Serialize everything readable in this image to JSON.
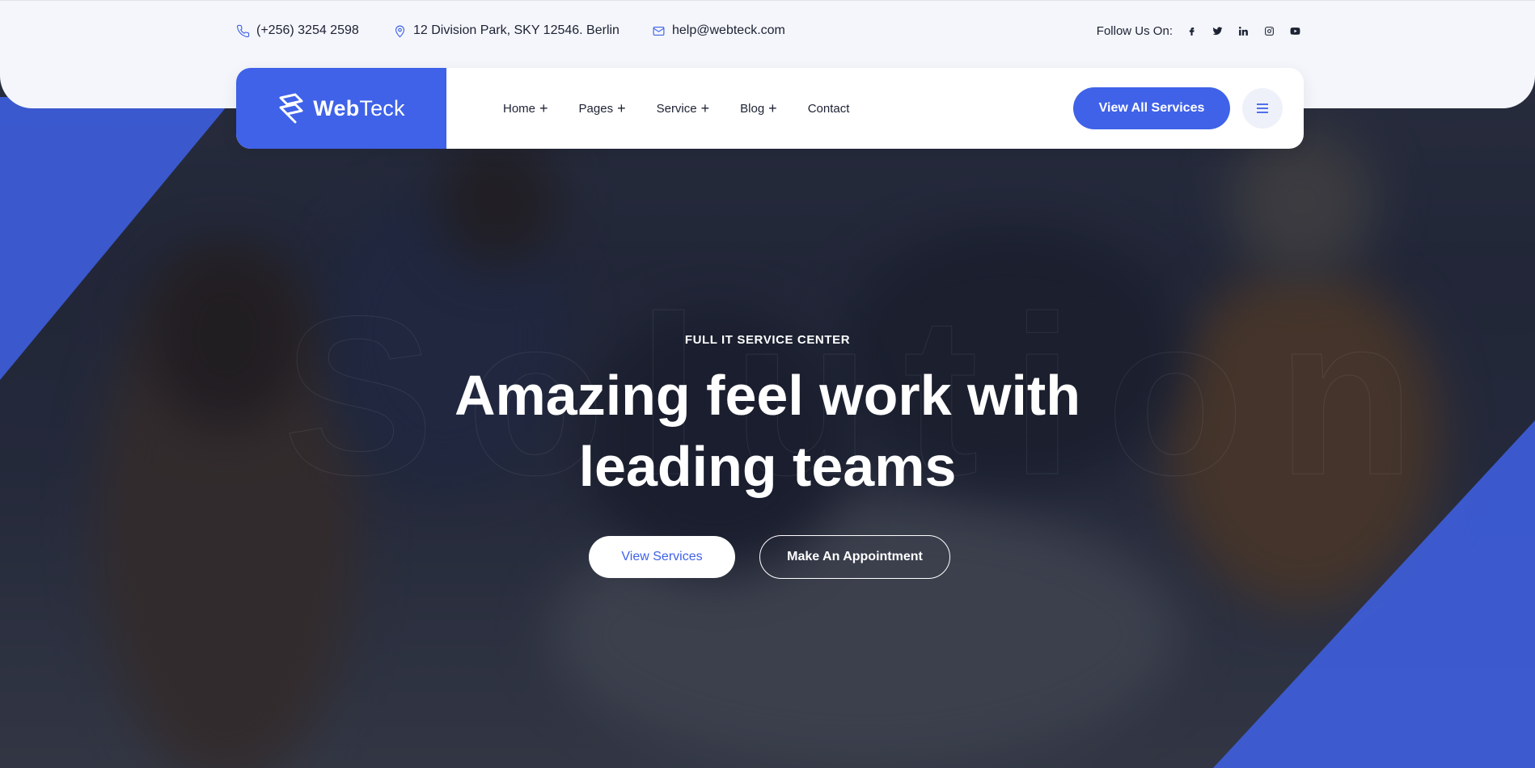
{
  "topbar": {
    "phone": "(+256) 3254 2598",
    "address": "12 Division Park, SKY 12546. Berlin",
    "email": "help@webteck.com",
    "follow_label": "Follow Us On:",
    "social_icons": [
      "facebook-icon",
      "twitter-icon",
      "linkedin-icon",
      "instagram-icon",
      "youtube-icon"
    ]
  },
  "brand": {
    "name_bold": "Web",
    "name_light": "Teck"
  },
  "nav": {
    "items": [
      {
        "label": "Home",
        "has_submenu": true
      },
      {
        "label": "Pages",
        "has_submenu": true
      },
      {
        "label": "Service",
        "has_submenu": true
      },
      {
        "label": "Blog",
        "has_submenu": true
      },
      {
        "label": "Contact",
        "has_submenu": false
      }
    ],
    "cta_label": "View All Services",
    "menu_icon": "hamburger-icon"
  },
  "hero": {
    "kicker": "FULL IT SERVICE CENTER",
    "headline_line1": "Amazing feel work with",
    "headline_line2": "leading teams",
    "primary_button": "View Services",
    "secondary_button": "Make An Appointment"
  },
  "colors": {
    "accent": "#3f62e8",
    "topbar_bg": "#f4f6fb",
    "text_dark": "#1d2233"
  }
}
